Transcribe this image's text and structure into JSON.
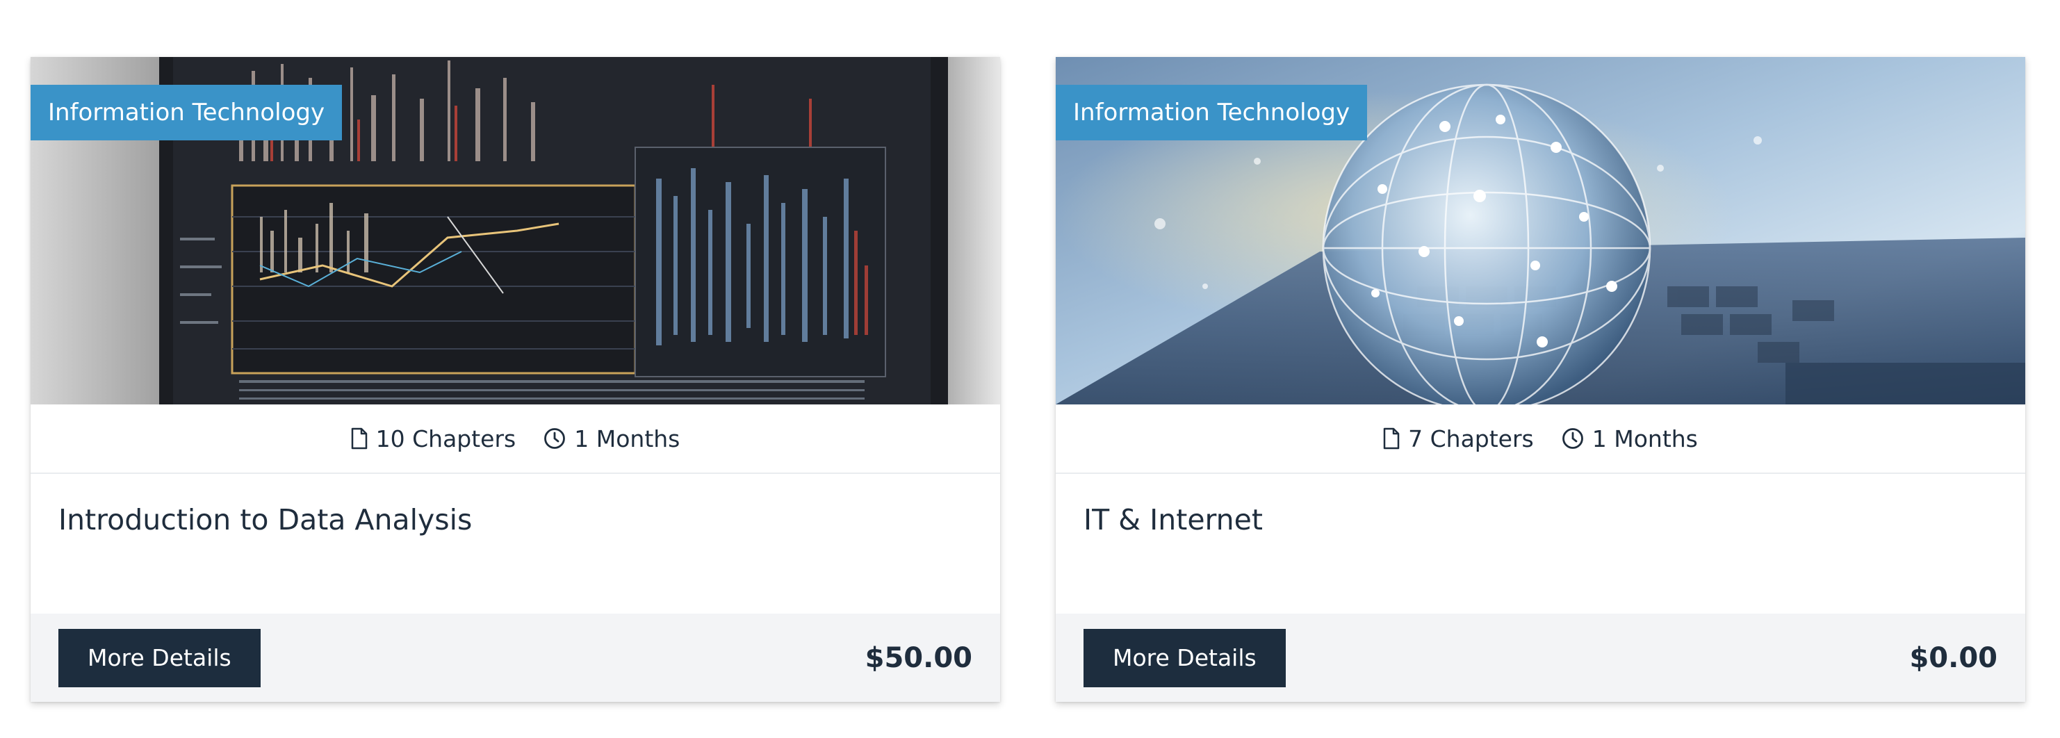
{
  "courses": [
    {
      "category": "Information Technology",
      "chapters": "10 Chapters",
      "duration": "1 Months",
      "title": "Introduction to Data Analysis",
      "button_label": "More Details",
      "price": "$50.00",
      "thumbnail": "data-dashboard-screens"
    },
    {
      "category": "Information Technology",
      "chapters": "7 Chapters",
      "duration": "1 Months",
      "title": "IT & Internet",
      "button_label": "More Details",
      "price": "$0.00",
      "thumbnail": "globe-on-laptop"
    }
  ],
  "colors": {
    "badge": "#3a93c8",
    "button": "#1d2d3e",
    "footer": "#f3f4f6",
    "text": "#1f2d3d"
  }
}
